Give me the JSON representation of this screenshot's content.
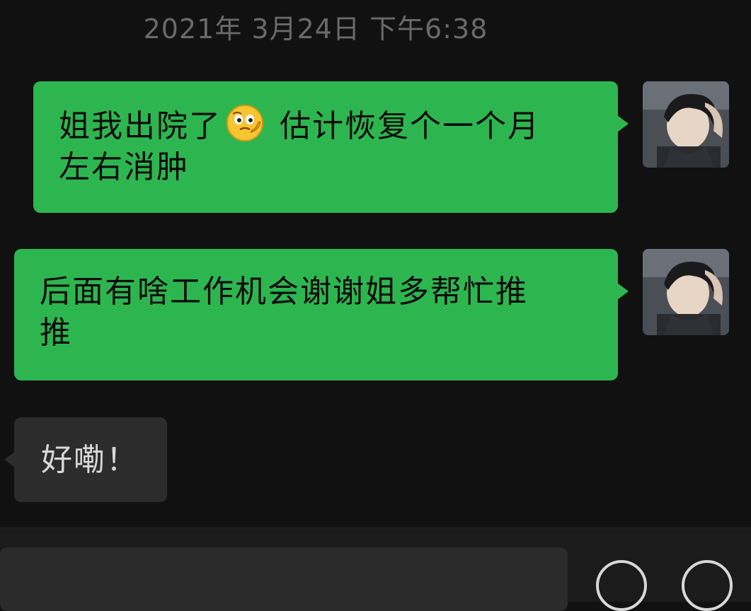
{
  "timestamp": "2021年 3月24日 下午6:38",
  "messages": [
    {
      "direction": "outgoing",
      "text_before_emoji": "姐我出院了",
      "emoji": "thinking-face-emoji",
      "text_after_emoji": " 估计恢复个一个月",
      "line2": "左右消肿"
    },
    {
      "direction": "outgoing",
      "line1": "后面有啥工作机会谢谢姐多帮忙推",
      "line2": "推"
    },
    {
      "direction": "incoming",
      "text": "好嘞！"
    }
  ],
  "colors": {
    "outgoing_bubble": "#2db64f",
    "incoming_bubble": "#2c2c2c",
    "background": "#111111",
    "timestamp": "#6a6a6a"
  }
}
